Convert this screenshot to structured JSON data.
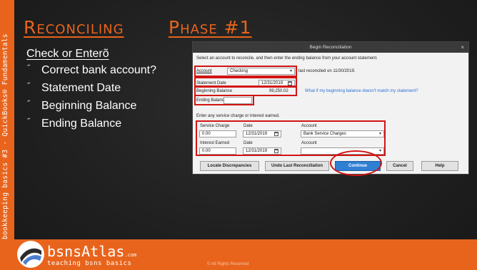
{
  "slide": {
    "title_part1": "Reconciling",
    "title_part2": "Phase #1",
    "subheading": "Check or Enterõ",
    "bullets": [
      {
        "mark": "˝",
        "text": "Correct bank account?"
      },
      {
        "mark": "˝",
        "text": "Statement Date"
      },
      {
        "mark": "˝",
        "text": "Beginning Balance"
      },
      {
        "mark": "˝",
        "text": "Ending Balance"
      }
    ],
    "side_text": "bookkeeping basics #3 - QuickBooks® Fundamentals",
    "brand": "bsnsAtlas",
    "brand_suffix": ".com",
    "tagline": "teaching bsns basics",
    "copyright": "© All Rights Reserved",
    "accent_color": "#e8641c"
  },
  "dialog": {
    "title": "Begin Reconciliation",
    "close": "×",
    "instruction": "Select an account to reconcile, and then enter the ending balance from your account statement.",
    "account_label": "Account",
    "account_value": "Checking",
    "last_reconciled": "last reconciled on 11/30/2019.",
    "statement_date_label": "Statement Date",
    "statement_date_value": "12/31/2019",
    "beginning_balance_label": "Beginning Balance",
    "beginning_balance_value": "99,250.02",
    "help_link": "What if my beginning balance doesn't match my statement?",
    "ending_balance_label": "Ending Balance",
    "ending_balance_value": "",
    "service_prompt": "Enter any service charge or interest earned.",
    "service_charge_label": "Service Charge",
    "date_label": "Date",
    "account_col_label": "Account",
    "service_charge_value": "0.00",
    "service_date_value": "12/31/2019",
    "service_account_value": "Bank Service Charges",
    "interest_earned_label": "Interest Earned",
    "interest_date_label": "Date",
    "interest_account_label": "Account",
    "interest_earned_value": "0.00",
    "interest_date_value": "12/31/2019",
    "interest_account_value": "",
    "buttons": {
      "locate": "Locate Discrepancies",
      "undo": "Undo Last Reconciliation",
      "continue": "Continue",
      "cancel": "Cancel",
      "help": "Help"
    }
  }
}
